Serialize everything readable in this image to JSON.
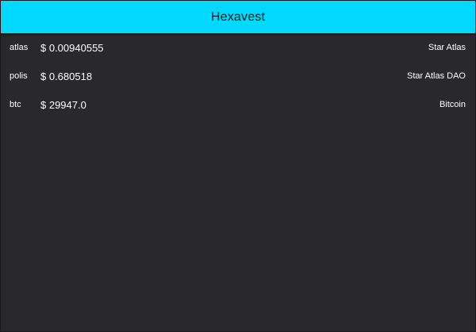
{
  "app_bar": {
    "title": "Hexavest",
    "color": "#00d8ff"
  },
  "background_color": "#29292b",
  "coins": [
    {
      "symbol": "atlas",
      "price": "$ 0.00940555",
      "name": "Star Atlas"
    },
    {
      "symbol": "polis",
      "price": "$ 0.680518",
      "name": "Star Atlas DAO"
    },
    {
      "symbol": "btc",
      "price": "$ 29947.0",
      "name": "Bitcoin"
    }
  ]
}
